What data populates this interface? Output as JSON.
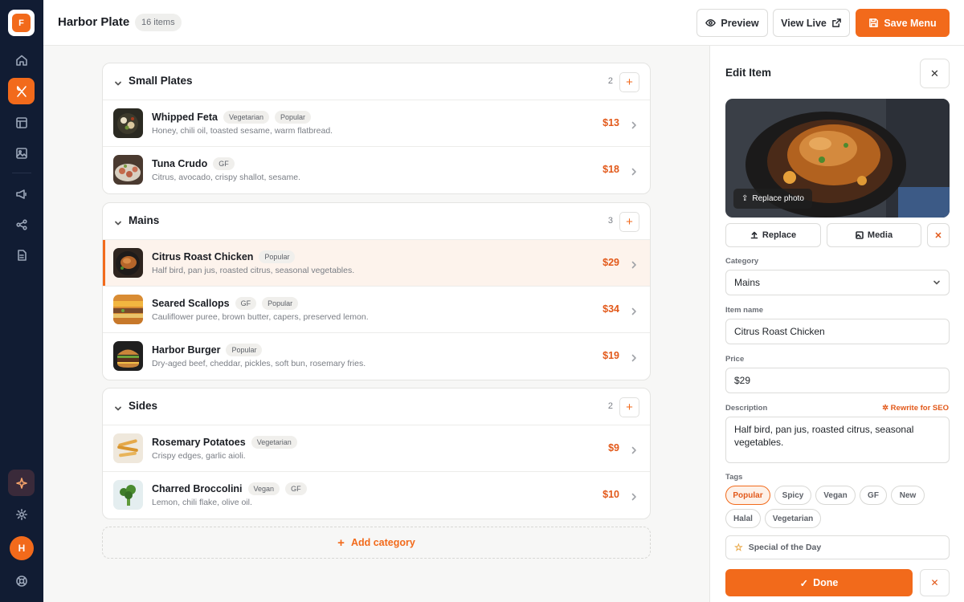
{
  "app": {
    "logo_letter": "F",
    "accent": "#f26a1b"
  },
  "sidebar": {
    "items": [
      {
        "icon": "home-icon"
      },
      {
        "icon": "utensils-icon",
        "active": true
      },
      {
        "icon": "layout-icon"
      },
      {
        "icon": "image-icon"
      },
      {
        "icon": "megaphone-icon"
      },
      {
        "icon": "share-icon"
      },
      {
        "icon": "document-icon"
      }
    ],
    "bottom": [
      {
        "icon": "sparkle-icon"
      },
      {
        "icon": "gear-icon"
      }
    ],
    "avatar": "H",
    "help_icon": "lifebuoy-icon"
  },
  "header": {
    "title": "Harbor Plate",
    "count": "16 items",
    "preview": "Preview",
    "view_live": "View Live",
    "save": "Save Menu"
  },
  "categories": [
    {
      "name": "Small Plates",
      "count": "2",
      "add": "+",
      "items": [
        {
          "name": "Whipped Feta",
          "tags": [
            "Vegetarian",
            "Popular"
          ],
          "desc": "Honey, chili oil, toasted sesame, warm flatbread.",
          "price": "$13"
        },
        {
          "name": "Tuna Crudo",
          "tags": [
            "GF"
          ],
          "desc": "Citrus, avocado, crispy shallot, sesame.",
          "price": "$18"
        }
      ]
    },
    {
      "name": "Mains",
      "count": "3",
      "add": "+",
      "items": [
        {
          "name": "Citrus Roast Chicken",
          "tags": [
            "Popular"
          ],
          "desc": "Half bird, pan jus, roasted citrus, seasonal vegetables.",
          "price": "$29",
          "selected": true
        },
        {
          "name": "Seared Scallops",
          "tags": [
            "GF",
            "Popular"
          ],
          "desc": "Cauliflower puree, brown butter, capers, preserved lemon.",
          "price": "$34"
        },
        {
          "name": "Harbor Burger",
          "tags": [
            "Popular"
          ],
          "desc": "Dry-aged beef, cheddar, pickles, soft bun, rosemary fries.",
          "price": "$19"
        }
      ]
    },
    {
      "name": "Sides",
      "count": "2",
      "add": "+",
      "items": [
        {
          "name": "Rosemary Potatoes",
          "tags": [
            "Vegetarian"
          ],
          "desc": "Crispy edges, garlic aioli.",
          "price": "$9"
        },
        {
          "name": "Charred Broccolini",
          "tags": [
            "Vegan",
            "GF"
          ],
          "desc": "Lemon, chili flake, olive oil.",
          "price": "$10"
        }
      ]
    }
  ],
  "add_category": "Add category",
  "editor": {
    "title": "Edit Item",
    "replace_photo": "Replace photo",
    "replace": "Replace",
    "media": "Media",
    "category_label": "Category",
    "category_value": "Mains",
    "name_label": "Item name",
    "name_value": "Citrus Roast Chicken",
    "price_label": "Price",
    "price_value": "$29",
    "desc_label": "Description",
    "rewrite": "Rewrite for SEO",
    "desc_value": "Half bird, pan jus, roasted citrus, seasonal vegetables.",
    "tags_label": "Tags",
    "tags": [
      {
        "label": "Popular",
        "on": true
      },
      {
        "label": "Spicy"
      },
      {
        "label": "Vegan"
      },
      {
        "label": "GF"
      },
      {
        "label": "New"
      },
      {
        "label": "Halal"
      },
      {
        "label": "Vegetarian"
      }
    ],
    "special": "Special of the Day",
    "done": "Done"
  }
}
